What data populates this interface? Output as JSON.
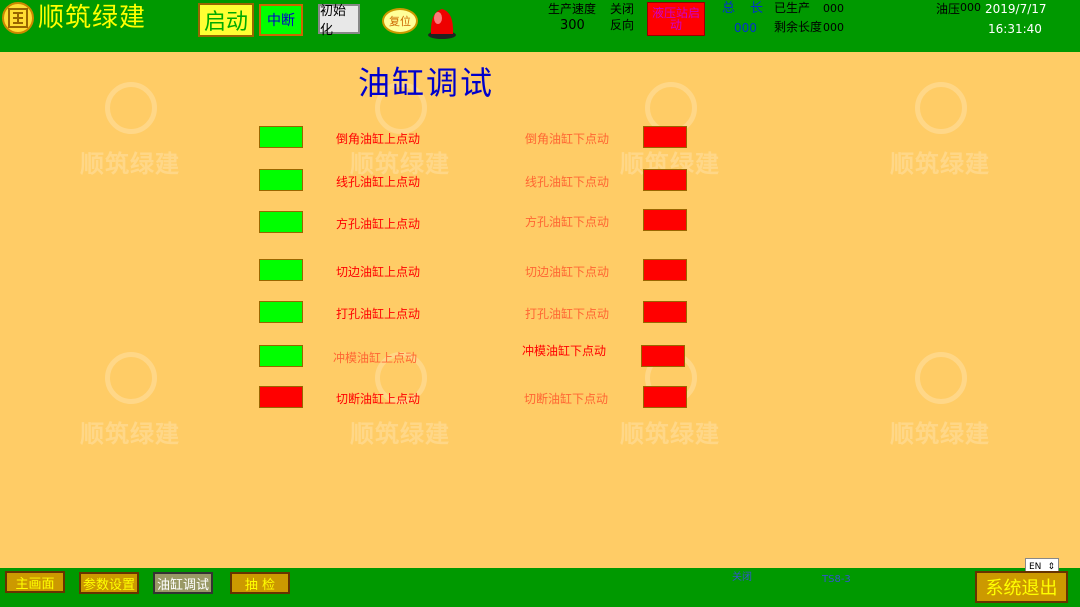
{
  "header": {
    "logo_text": "顺筑绿建",
    "start_label": "启动",
    "stop_label": "中断",
    "init_label": "初始化",
    "reset_label": "复位",
    "speed_label": "生产速度",
    "speed_value": "300",
    "close_label": "关闭",
    "reverse_label": "反向",
    "hydraulic_label": "液压站启动",
    "total_label": "总",
    "length_label": "长",
    "total_value": "000",
    "produced_label": "已生产",
    "produced_value": "000",
    "remaining_label": "剩余长度",
    "remaining_value": "000",
    "oil_pressure_label": "油压",
    "oil_pressure_value": "000",
    "date": "2019/7/17",
    "time": "16:31:40"
  },
  "main": {
    "title": "油缸调试",
    "watermark_text": "顺筑绿建",
    "up_rows": [
      {
        "label": "倒角油缸上点动",
        "state": "green",
        "label_color": "red"
      },
      {
        "label": "线孔油缸上点动",
        "state": "green",
        "label_color": "red"
      },
      {
        "label": "方孔油缸上点动",
        "state": "green",
        "label_color": "red"
      },
      {
        "label": "切边油缸上点动",
        "state": "green",
        "label_color": "red"
      },
      {
        "label": "打孔油缸上点动",
        "state": "green",
        "label_color": "red"
      },
      {
        "label": "冲模油缸上点动",
        "state": "green",
        "label_color": "orange"
      },
      {
        "label": "切断油缸上点动",
        "state": "red",
        "label_color": "red"
      }
    ],
    "down_rows": [
      {
        "label": "倒角油缸下点动",
        "state": "red",
        "label_color": "orange"
      },
      {
        "label": "线孔油缸下点动",
        "state": "red",
        "label_color": "orange"
      },
      {
        "label": "方孔油缸下点动",
        "state": "red",
        "label_color": "orange"
      },
      {
        "label": "切边油缸下点动",
        "state": "red",
        "label_color": "orange"
      },
      {
        "label": "打孔油缸下点动",
        "state": "red",
        "label_color": "orange"
      },
      {
        "label": "冲模油缸下点动",
        "state": "red",
        "label_color": "red"
      },
      {
        "label": "切断油缸下点动",
        "state": "red",
        "label_color": "orange"
      }
    ]
  },
  "footer": {
    "nav": [
      {
        "label": "主画面",
        "active": false
      },
      {
        "label": "参数设置",
        "active": false
      },
      {
        "label": "油缸调试",
        "active": true
      },
      {
        "label": "抽  检",
        "active": false
      }
    ],
    "close_text": "关闭",
    "status_text": "TS8-3",
    "lang_label": "EN",
    "exit_label": "系统退出"
  },
  "colors": {
    "topbar": "#009900",
    "background": "#ffcc66",
    "indicator_green": "#00ff00",
    "indicator_red": "#ff0000",
    "title": "#0000cc"
  }
}
